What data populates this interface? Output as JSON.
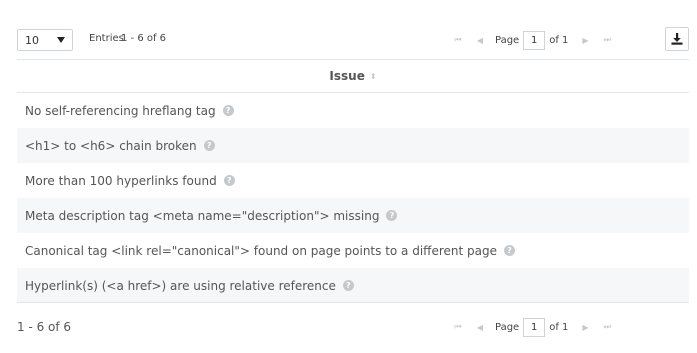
{
  "toolbar": {
    "page_size": "10",
    "entries_label": "Entries",
    "range": "1 - 6 of 6",
    "pager": {
      "page_word": "Page",
      "current_page": "1",
      "of_text": "of 1"
    }
  },
  "icons": {
    "first": "⏮",
    "prev": "◀",
    "next": "▶",
    "last": "⏭",
    "sort": "⬍",
    "help": "?"
  },
  "table": {
    "header": "Issue",
    "rows": [
      "No self-referencing hreflang tag",
      "<h1> to <h6> chain broken",
      "More than 100 hyperlinks found",
      "Meta description tag <meta name=\"description\"> missing",
      "Canonical tag <link rel=\"canonical\"> found on page points to a different page",
      "Hyperlink(s) (<a href>) are using relative reference"
    ]
  },
  "footer": {
    "range": "1 - 6 of 6",
    "pager": {
      "page_word": "Page",
      "current_page": "1",
      "of_text": "of 1"
    }
  }
}
